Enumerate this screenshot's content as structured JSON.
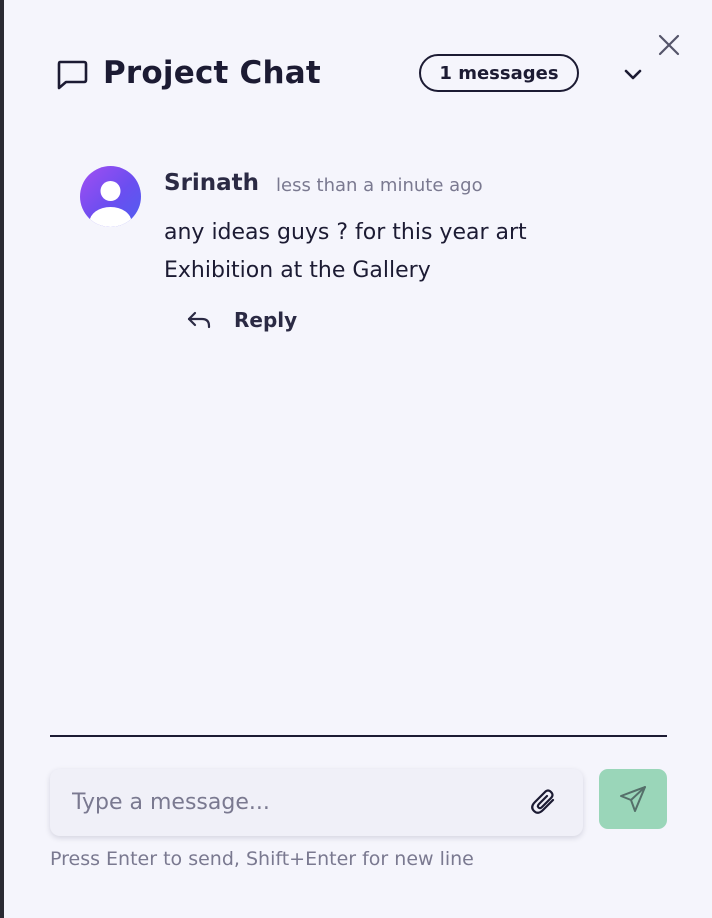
{
  "header": {
    "title": "Project Chat",
    "message_count_badge": "1 messages",
    "chat_icon": "message-square-icon",
    "collapse_icon": "chevron-down-icon",
    "close_icon": "close-icon"
  },
  "messages": [
    {
      "author": "Srinath",
      "timestamp": "less than a minute ago",
      "text": "any ideas guys ? for this year art Exhibition at the Gallery",
      "avatar_icon": "user-avatar-icon",
      "reply_label": "Reply",
      "reply_icon": "reply-icon"
    }
  ],
  "composer": {
    "placeholder": "Type a message...",
    "value": "",
    "attach_icon": "paperclip-icon",
    "send_icon": "send-icon",
    "hint": "Press Enter to send, Shift+Enter for new line"
  },
  "colors": {
    "background": "#f5f5fc",
    "text": "#1c1b33",
    "muted_text": "#7a7990",
    "send_button": "#9ad6b9",
    "avatar_gradient": [
      "#a24ff2",
      "#4f5ff0"
    ]
  }
}
